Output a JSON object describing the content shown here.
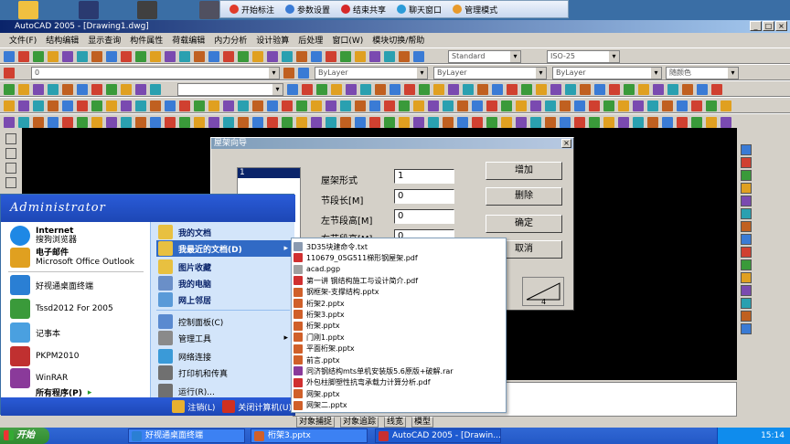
{
  "meeting_toolbar": {
    "items": [
      {
        "label": "开始标注",
        "icon": "pen-icon",
        "color": "#e03b2a"
      },
      {
        "label": "参数设置",
        "icon": "gear-icon",
        "color": "#3a7bd5"
      },
      {
        "label": "结束共享",
        "icon": "stop-share-icon",
        "color": "#d62828"
      },
      {
        "label": "聊天窗口",
        "icon": "chat-icon",
        "color": "#2b9bd8"
      },
      {
        "label": "管理模式",
        "icon": "admin-icon",
        "color": "#e89a2b"
      }
    ]
  },
  "cad": {
    "title": "AutoCAD 2005 - [Drawing1.dwg]",
    "menu": [
      "文件(F)",
      "结构编辑",
      "显示查询",
      "构件属性",
      "荷载编辑",
      "内力分析",
      "设计验算",
      "后处理",
      "窗口(W)",
      "模块切换/帮助"
    ],
    "style_combo": "Standard",
    "dim_combo": "ISO-25",
    "layer_combo": "0",
    "color_combo": "ByLayer",
    "linetype_combo": "ByLayer",
    "lineweight_combo": "ByLayer",
    "plot_combo": "随颜色"
  },
  "dialog": {
    "title": "屋架向导",
    "list_selected": "1",
    "fields": [
      {
        "label": "屋架形式",
        "value": "1"
      },
      {
        "label": "节段长[M]",
        "value": "0"
      },
      {
        "label": "左节段高[M]",
        "value": "0"
      },
      {
        "label": "右节段高[M]",
        "value": "0"
      }
    ],
    "buttons": {
      "add": "增加",
      "delete": "删除",
      "ok": "确定",
      "cancel": "取消"
    },
    "preview_number": "4"
  },
  "start_menu": {
    "user": "Administrator",
    "pinned": [
      {
        "title": "Internet",
        "sub": "搜狗浏览器",
        "icon": "browser-icon",
        "color": "#1e88e5"
      },
      {
        "title": "电子邮件",
        "sub": "Microsoft Office Outlook",
        "icon": "mail-icon",
        "color": "#e0a020"
      }
    ],
    "recent_programs": [
      {
        "label": "好视通桌面终端",
        "icon": "video-conf-icon",
        "color": "#2a7fd4"
      },
      {
        "label": "Tssd2012 For 2005",
        "icon": "tssd-icon",
        "color": "#3a9a3a"
      },
      {
        "label": "记事本",
        "icon": "notepad-icon",
        "color": "#4aa0e0"
      },
      {
        "label": "PKPM2010",
        "icon": "pkpm-icon",
        "color": "#c03030"
      },
      {
        "label": "WinRAR",
        "icon": "winrar-icon",
        "color": "#8a3a9a"
      }
    ],
    "all_programs": "所有程序(P)",
    "right_items": [
      {
        "label": "我的文档",
        "icon": "folder-icon",
        "color": "#e8c040",
        "bold": true
      },
      {
        "label": "我最近的文档(D)",
        "icon": "recent-folder-icon",
        "color": "#e8c040",
        "bold": true,
        "highlight": true
      },
      {
        "label": "图片收藏",
        "icon": "pictures-icon",
        "color": "#e8c040",
        "bold": true
      },
      {
        "label": "我的电脑",
        "icon": "computer-icon",
        "color": "#6a8fc8",
        "bold": true
      },
      {
        "label": "网上邻居",
        "icon": "network-icon",
        "color": "#5a9ad8",
        "bold": true
      },
      {
        "label": "控制面板(C)",
        "icon": "control-panel-icon",
        "color": "#5a8ad0",
        "bold": false
      },
      {
        "label": "管理工具",
        "icon": "admin-tools-icon",
        "color": "#8a8a8a",
        "bold": false
      },
      {
        "label": "网络连接",
        "icon": "network-conn-icon",
        "color": "#3a9ad8",
        "bold": false
      },
      {
        "label": "打印机和传真",
        "icon": "printer-icon",
        "color": "#707070",
        "bold": false
      },
      {
        "label": "运行(R)...",
        "icon": "run-icon",
        "color": "#707070",
        "bold": false
      }
    ],
    "logoff": "注销(L)",
    "shutdown": "关闭计算机(U)"
  },
  "recent_docs": [
    {
      "label": "3D35块建命令.txt",
      "icon": "txt-icon",
      "color": "#8a9ab0"
    },
    {
      "label": "110679_05G511梯形钢屋架.pdf",
      "icon": "pdf-icon",
      "color": "#d03030"
    },
    {
      "label": "acad.pgp",
      "icon": "file-icon",
      "color": "#a0a0a0"
    },
    {
      "label": "第一讲 钢结构施工与设计简介.pdf",
      "icon": "pdf-icon",
      "color": "#d03030"
    },
    {
      "label": "钢框架-支撑结构.pptx",
      "icon": "pptx-icon",
      "color": "#d0602a"
    },
    {
      "label": "桁架2.pptx",
      "icon": "pptx-icon",
      "color": "#d0602a"
    },
    {
      "label": "桁架3.pptx",
      "icon": "pptx-icon",
      "color": "#d0602a"
    },
    {
      "label": "桁架.pptx",
      "icon": "pptx-icon",
      "color": "#d0602a"
    },
    {
      "label": "门刚1.pptx",
      "icon": "pptx-icon",
      "color": "#d0602a"
    },
    {
      "label": "平面桁架.pptx",
      "icon": "pptx-icon",
      "color": "#d0602a"
    },
    {
      "label": "前言.pptx",
      "icon": "pptx-icon",
      "color": "#d0602a"
    },
    {
      "label": "同济钢结构mts单机安装版5.6原版+破解.rar",
      "icon": "rar-icon",
      "color": "#8a3a9a"
    },
    {
      "label": "外包柱脚塑性抗弯承载力计算分析.pdf",
      "icon": "pdf-icon",
      "color": "#d03030"
    },
    {
      "label": "网架.pptx",
      "icon": "pptx-icon",
      "color": "#d0602a"
    },
    {
      "label": "网架二.pptx",
      "icon": "pptx-icon",
      "color": "#d0602a"
    }
  ],
  "status_bar": [
    "对象捕捉",
    "对象追踪",
    "线宽",
    "模型"
  ],
  "taskbar": {
    "start": "开始",
    "tasks": [
      {
        "label": "好视通桌面终端",
        "color": "#2a7fd4"
      },
      {
        "label": "桁架3.pptx",
        "color": "#d0602a"
      },
      {
        "label": "AutoCAD 2005 - [Drawin...",
        "color": "#c83030"
      }
    ],
    "clock": "15:14"
  }
}
